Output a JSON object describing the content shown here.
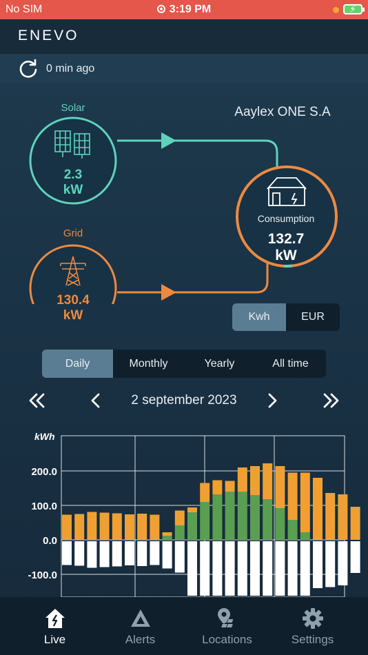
{
  "status_bar": {
    "carrier": "No SIM",
    "time": "3:19 PM"
  },
  "header": {
    "logo": "ENEVO"
  },
  "refresh": {
    "text": "0 min ago",
    "icon": "refresh-icon"
  },
  "flow": {
    "site_name": "Aaylex ONE S.A",
    "solar": {
      "label": "Solar",
      "value": "2.3",
      "unit": "kW",
      "color": "#5fd3bc",
      "icon": "solar-panel-icon"
    },
    "grid": {
      "label": "Grid",
      "value": "130.4",
      "unit": "kW",
      "color": "#ee8a40",
      "icon": "power-pylon-icon"
    },
    "consumption": {
      "label": "Consumption",
      "value": "132.7",
      "unit": "kW",
      "icon": "building-icon"
    }
  },
  "unit_toggle": {
    "options": [
      "Kwh",
      "EUR"
    ],
    "selected": "Kwh"
  },
  "period_tabs": {
    "options": [
      "Daily",
      "Monthly",
      "Yearly",
      "All time"
    ],
    "selected": "Daily"
  },
  "date_nav": {
    "date": "2 september 2023"
  },
  "chart_data": {
    "type": "bar",
    "stacked": true,
    "ylabel": "kWh",
    "yticks": [
      "200.0",
      "100.0",
      "0.0",
      "-100.0"
    ],
    "ylim": [
      -160,
      260
    ],
    "x": [
      0,
      1,
      2,
      3,
      4,
      5,
      6,
      7,
      8,
      9,
      10,
      11,
      12,
      13,
      14,
      15,
      16,
      17,
      18,
      19,
      20,
      21,
      22,
      23
    ],
    "series": [
      {
        "color": "#5a9e52",
        "values": [
          0,
          0,
          0,
          0,
          0,
          0,
          0,
          0,
          12,
          42,
          80,
          110,
          132,
          140,
          140,
          130,
          118,
          92,
          58,
          22,
          0,
          0,
          0,
          0
        ]
      },
      {
        "color": "#f0a032",
        "values": [
          73,
          75,
          81,
          79,
          77,
          74,
          76,
          73,
          10,
          43,
          14,
          55,
          41,
          31,
          70,
          84,
          104,
          122,
          137,
          173,
          180,
          136,
          132,
          96
        ]
      },
      {
        "color": "#ffffff",
        "values": [
          -73,
          -75,
          -81,
          -79,
          -77,
          -74,
          -76,
          -73,
          -83,
          -95,
          -162,
          -162,
          -162,
          -162,
          -162,
          -162,
          -162,
          -162,
          -162,
          -162,
          -140,
          -137,
          -132,
          -96
        ]
      }
    ],
    "grid": true
  },
  "tab_bar": {
    "items": [
      {
        "label": "Live",
        "icon": "home-bolt-icon",
        "active": true
      },
      {
        "label": "Alerts",
        "icon": "alert-triangle-icon",
        "active": false
      },
      {
        "label": "Locations",
        "icon": "location-pin-icon",
        "active": false
      },
      {
        "label": "Settings",
        "icon": "gear-icon",
        "active": false
      }
    ]
  }
}
